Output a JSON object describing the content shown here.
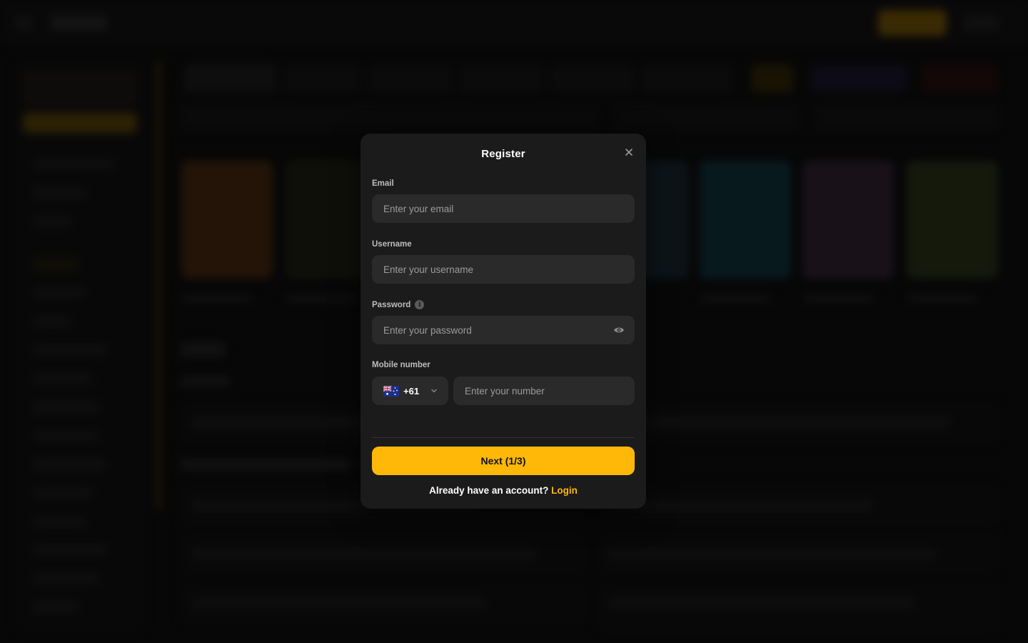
{
  "modal": {
    "title": "Register",
    "close_icon": "close-icon",
    "email": {
      "label": "Email",
      "placeholder": "Enter your email",
      "value": ""
    },
    "username": {
      "label": "Username",
      "placeholder": "Enter your username",
      "value": ""
    },
    "password": {
      "label": "Password",
      "placeholder": "Enter your password",
      "value": "",
      "info_icon": "info-icon",
      "toggle_icon": "eye-icon"
    },
    "mobile": {
      "label": "Mobile number",
      "country_flag": "australia-flag-icon",
      "dial_code": "+61",
      "placeholder": "Enter your number",
      "value": ""
    },
    "next_button": "Next (1/3)",
    "login_prompt": "Already have an account?",
    "login_link": "Login"
  },
  "colors": {
    "accent": "#ffb808",
    "modal_bg": "#1b1b1b",
    "input_bg": "#2a2a2a",
    "page_bg": "#0d0d0d"
  }
}
